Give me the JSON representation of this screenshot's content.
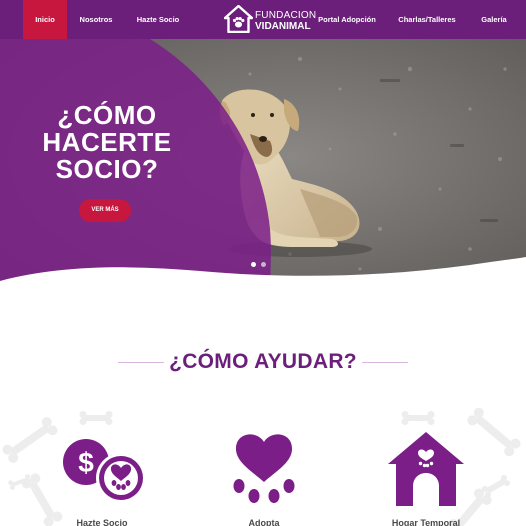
{
  "nav": {
    "items": [
      {
        "label": "Inicio",
        "active": true
      },
      {
        "label": "Nosotros",
        "active": false
      },
      {
        "label": "Hazte Socio",
        "active": false
      },
      {
        "label": "Portal Adopción",
        "active": false
      },
      {
        "label": "Charlas/Talleres",
        "active": false
      },
      {
        "label": "Galería",
        "active": false
      }
    ],
    "logo": {
      "line1": "FUNDACION",
      "line2": "VIDANIMAL",
      "icon": "house-paw-logo-icon"
    }
  },
  "hero": {
    "title": "¿CÓMO HACERTE SOCIO?",
    "button_label": "VER MÁS",
    "slides": 2,
    "active_slide": 1,
    "image": "stray-dog-photo"
  },
  "help": {
    "title": "¿CÓMO AYUDAR?",
    "cards": [
      {
        "icon": "donation-coin-paw-icon",
        "label": "Hazte Socio"
      },
      {
        "icon": "heart-paw-icon",
        "label": "Adopta"
      },
      {
        "icon": "dog-house-icon",
        "label": "Hogar Temporal"
      }
    ]
  },
  "colors": {
    "brand_purple": "#6b1f7a",
    "accent_red": "#c8173f",
    "help_purple": "#7b1e88"
  }
}
